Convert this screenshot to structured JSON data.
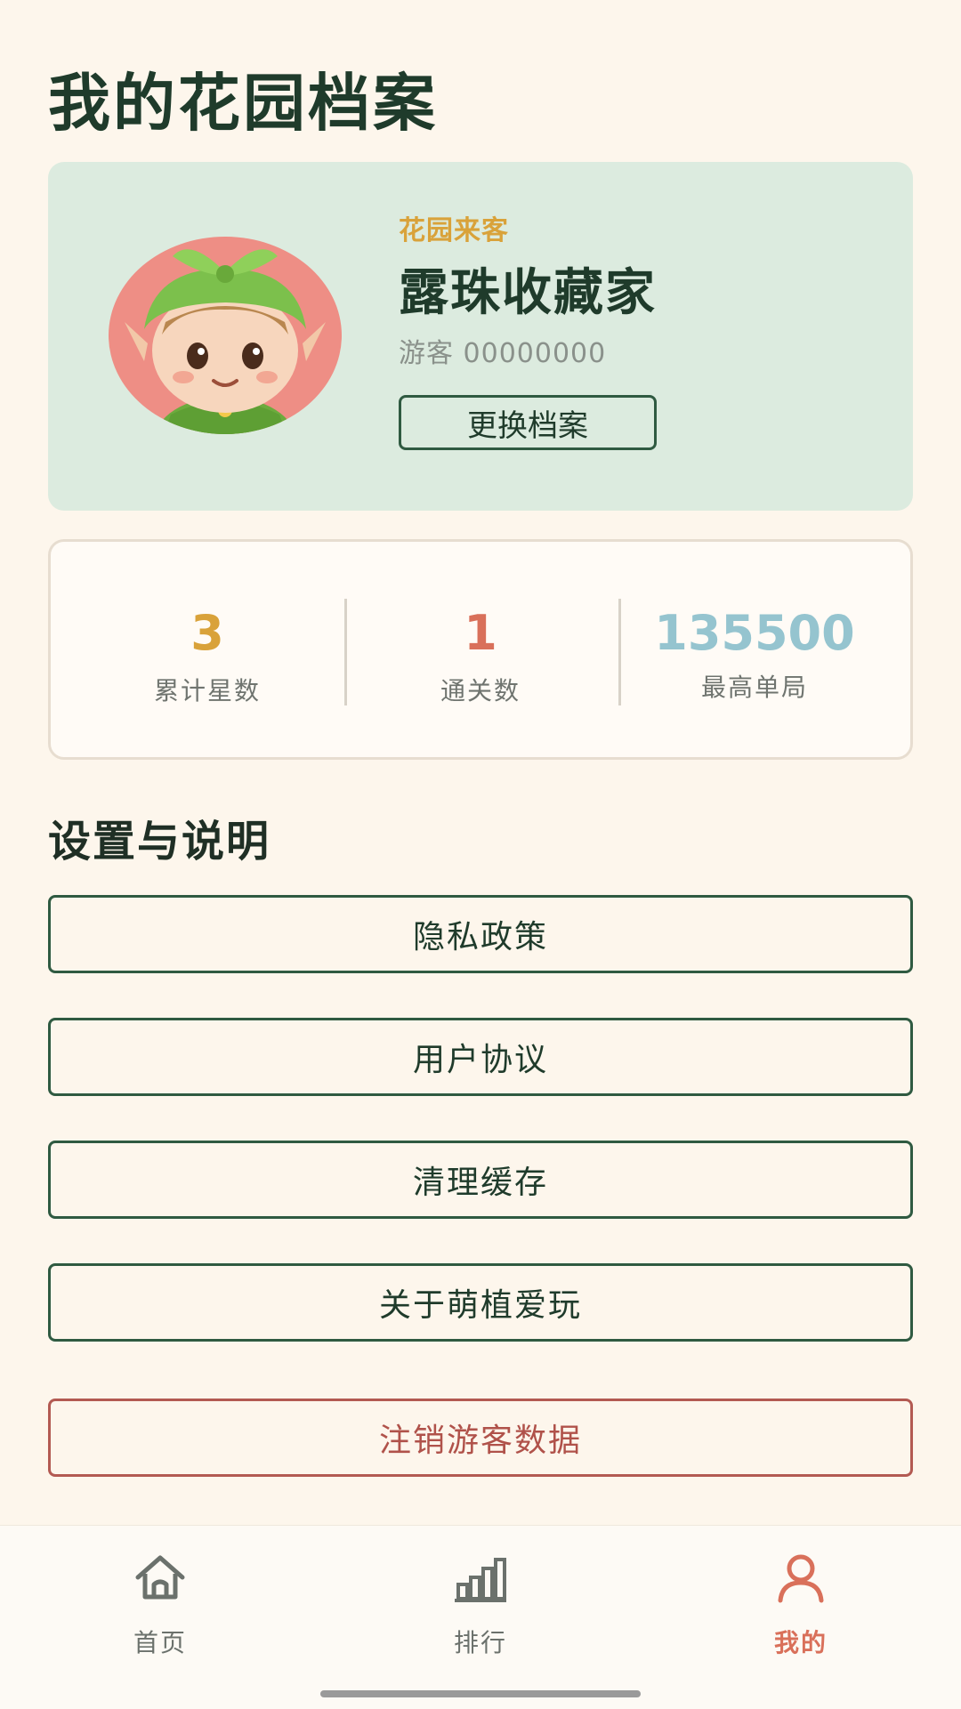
{
  "page": {
    "title": "我的花园档案"
  },
  "profile": {
    "badge": "花园来客",
    "nickname": "露珠收藏家",
    "visitor_id": "游客 00000000",
    "switch_label": "更换档案",
    "avatar_icon": "leaf-elf-avatar"
  },
  "stats": [
    {
      "value": "3",
      "label": "累计星数",
      "color": "#d9a23a"
    },
    {
      "value": "1",
      "label": "通关数",
      "color": "#d9705a"
    },
    {
      "value": "135500",
      "label": "最高单局",
      "color": "#95c4cf"
    }
  ],
  "settings": {
    "title": "设置与说明",
    "items": [
      {
        "label": "隐私政策"
      },
      {
        "label": "用户协议"
      },
      {
        "label": "清理缓存"
      },
      {
        "label": "关于萌植爱玩"
      }
    ],
    "danger_label": "注销游客数据"
  },
  "nav": {
    "items": [
      {
        "label": "首页",
        "icon": "home-icon"
      },
      {
        "label": "排行",
        "icon": "bar-chart-icon"
      },
      {
        "label": "我的",
        "icon": "user-icon",
        "active": true
      }
    ],
    "active_color": "#d9705a"
  }
}
